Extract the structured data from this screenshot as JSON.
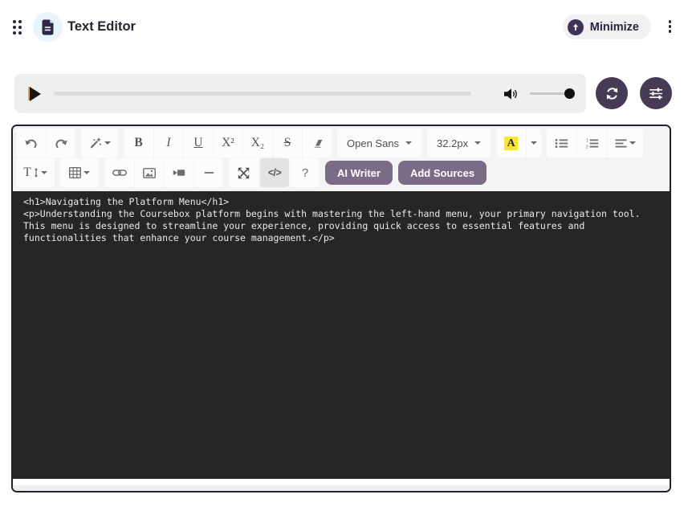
{
  "header": {
    "title": "Text Editor",
    "minimize_label": "Minimize"
  },
  "toolbar": {
    "font_family": "Open Sans",
    "font_size": "32.2px",
    "bold_label": "B",
    "italic_label": "I",
    "underline_label": "U",
    "superscript_label": "X²",
    "subscript_label": "X₂",
    "strikethrough_label": "S",
    "highlight_label": "A",
    "paragraph_label": "T",
    "code_view_label": "</>",
    "help_label": "?",
    "ai_writer_label": "AI Writer",
    "add_sources_label": "Add Sources"
  },
  "editor": {
    "code": "<h1>Navigating the Platform Menu</h1>\n<p>Understanding the Coursebox platform begins with mastering the left-hand menu, your primary navigation tool.\nThis menu is designed to streamline your experience, providing quick access to essential features and\nfunctionalities that enhance your course management.</p>"
  },
  "colors": {
    "accent_dark_purple": "#473a54",
    "button_purple": "#7a6b87",
    "highlight_yellow": "#f7e72e",
    "code_background": "#262626"
  }
}
